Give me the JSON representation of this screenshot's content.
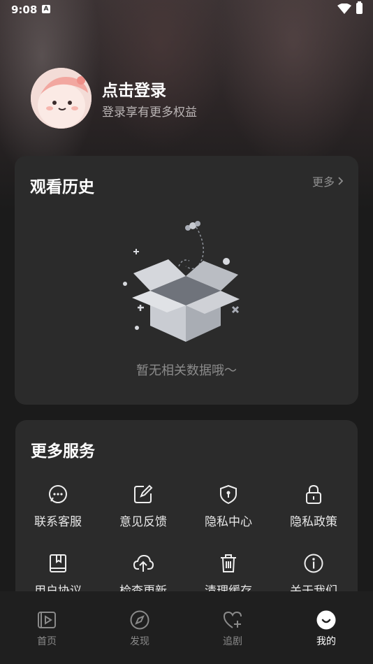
{
  "status_bar": {
    "time": "9:08"
  },
  "profile": {
    "title": "点击登录",
    "subtitle": "登录享有更多权益"
  },
  "history": {
    "title": "观看历史",
    "more_label": "更多",
    "empty_text": "暂无相关数据哦～"
  },
  "services": {
    "title": "更多服务",
    "items": [
      {
        "label": "联系客服",
        "icon": "chat-bubble-icon"
      },
      {
        "label": "意见反馈",
        "icon": "edit-icon"
      },
      {
        "label": "隐私中心",
        "icon": "shield-icon"
      },
      {
        "label": "隐私政策",
        "icon": "lock-icon"
      },
      {
        "label": "用户协议",
        "icon": "bookmark-book-icon"
      },
      {
        "label": "检查更新",
        "icon": "cloud-upload-icon"
      },
      {
        "label": "清理缓存",
        "icon": "trash-icon"
      },
      {
        "label": "关于我们",
        "icon": "info-icon"
      }
    ]
  },
  "bottom_nav": {
    "items": [
      {
        "label": "首页",
        "icon": "play-screen-icon"
      },
      {
        "label": "发现",
        "icon": "compass-icon"
      },
      {
        "label": "追剧",
        "icon": "heart-plus-icon"
      },
      {
        "label": "我的",
        "icon": "smile-face-icon",
        "active": true
      }
    ]
  },
  "colors": {
    "background": "#1b1b1b",
    "card": "#2b2b2b",
    "nav": "#1f1f1f",
    "muted_text": "#8b8b8b"
  }
}
